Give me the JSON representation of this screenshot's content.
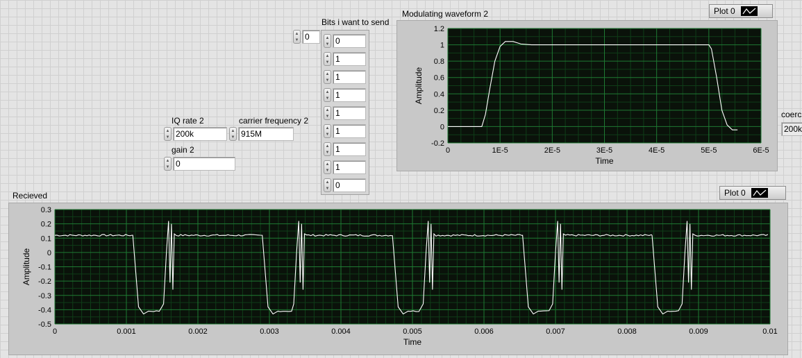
{
  "index_control": {
    "value": "0"
  },
  "bits": {
    "label": "Bits i want to send",
    "values": [
      "0",
      "1",
      "1",
      "1",
      "1",
      "1",
      "1",
      "1",
      "0"
    ]
  },
  "iq_rate": {
    "label": "IQ rate 2",
    "value": "200k"
  },
  "carrier": {
    "label": "carrier frequency 2",
    "value": "915M"
  },
  "gain": {
    "label": "gain 2",
    "value": "0"
  },
  "coerced": {
    "label": "coerc",
    "value": "200k"
  },
  "colors": {
    "plot_bg": "#0a120a",
    "grid_major": "#1f7a33",
    "grid_minor": "#0f3d18",
    "trace": "#ffffff",
    "panel": "#e4e4e4"
  },
  "waveform_top": {
    "title": "Modulating waveform 2",
    "legend": "Plot 0"
  },
  "waveform_bottom": {
    "title": "Recieved",
    "legend": "Plot 0"
  },
  "chart_data": [
    {
      "type": "line",
      "title": "Modulating waveform 2",
      "xlabel": "Time",
      "ylabel": "Amplitude",
      "xlim": [
        0,
        6e-05
      ],
      "ylim": [
        -0.2,
        1.2
      ],
      "xticks": [
        "0",
        "1E-5",
        "2E-5",
        "3E-5",
        "4E-5",
        "5E-5",
        "6E-5"
      ],
      "yticks": [
        "-0.2",
        "0",
        "0.2",
        "0.4",
        "0.6",
        "0.8",
        "1",
        "1.2"
      ],
      "grid": true,
      "legend": "top-right",
      "series": [
        {
          "name": "Plot 0",
          "x": [
            0,
            6.5e-06,
            7.2e-06,
            8e-06,
            9e-06,
            1e-05,
            1.1e-05,
            1.25e-05,
            1.4e-05,
            1.6e-05,
            2e-05,
            3e-05,
            4e-05,
            5e-05,
            5.05e-05,
            5.15e-05,
            5.25e-05,
            5.35e-05,
            5.45e-05,
            5.55e-05
          ],
          "y": [
            0,
            0,
            0.15,
            0.45,
            0.8,
            0.98,
            1.04,
            1.04,
            1.01,
            1.0,
            1.0,
            1.0,
            1.0,
            1.0,
            0.95,
            0.6,
            0.2,
            0.02,
            -0.04,
            -0.04
          ]
        }
      ]
    },
    {
      "type": "line",
      "title": "Recieved",
      "xlabel": "Time",
      "ylabel": "Amplitude",
      "xlim": [
        0,
        0.01
      ],
      "ylim": [
        -0.5,
        0.3
      ],
      "xticks": [
        "0",
        "0.001",
        "0.002",
        "0.003",
        "0.004",
        "0.005",
        "0.006",
        "0.007",
        "0.008",
        "0.009",
        "0.01"
      ],
      "yticks": [
        "-0.5",
        "-0.4",
        "-0.3",
        "-0.2",
        "-0.1",
        "0",
        "0.1",
        "0.2",
        "0.3"
      ],
      "grid": true,
      "legend": "top-right",
      "series": [
        {
          "name": "Plot 0",
          "period": 0.0018,
          "high": 0.12,
          "low": -0.41,
          "falls": [
            0.00109,
            0.0029,
            0.00472,
            0.00654,
            0.00835
          ],
          "rises": [
            0.0016,
            0.00342,
            0.00523,
            0.00704,
            0.00885
          ],
          "spike_max": 0.22,
          "spike_min": -0.26
        }
      ]
    }
  ]
}
